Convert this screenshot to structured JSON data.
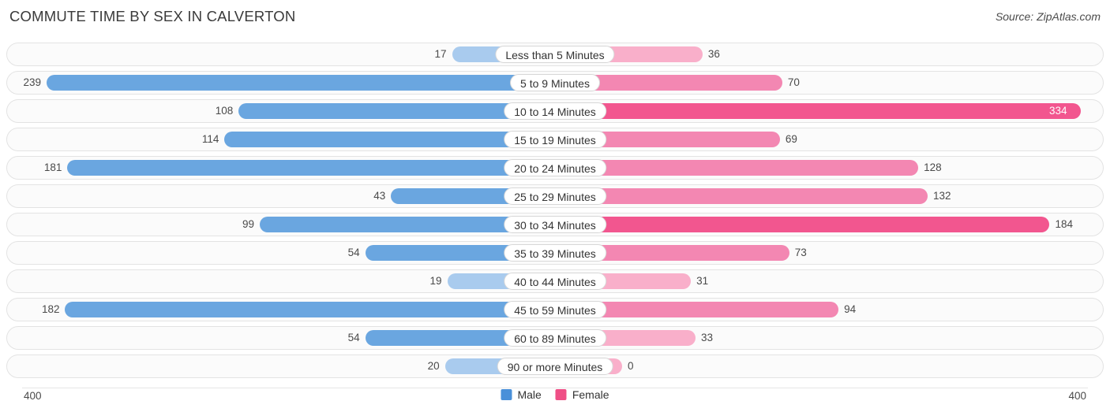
{
  "header": {
    "title": "COMMUTE TIME BY SEX IN CALVERTON",
    "source": "Source: ZipAtlas.com"
  },
  "legend": {
    "male": "Male",
    "female": "Female"
  },
  "axis": {
    "left": "400",
    "right": "400"
  },
  "chart_data": {
    "type": "bar",
    "title": "COMMUTE TIME BY SEX IN CALVERTON",
    "orientation": "horizontal-diverging",
    "xlabel": "",
    "ylabel": "",
    "axis_max": 400,
    "categories": [
      "Less than 5 Minutes",
      "5 to 9 Minutes",
      "10 to 14 Minutes",
      "15 to 19 Minutes",
      "20 to 24 Minutes",
      "25 to 29 Minutes",
      "30 to 34 Minutes",
      "35 to 39 Minutes",
      "40 to 44 Minutes",
      "45 to 59 Minutes",
      "60 to 89 Minutes",
      "90 or more Minutes"
    ],
    "series": [
      {
        "name": "Male",
        "color": "#4a90d9",
        "values": [
          17,
          239,
          108,
          114,
          181,
          43,
          99,
          54,
          19,
          182,
          54,
          20
        ]
      },
      {
        "name": "Female",
        "color": "#ef4f86",
        "values": [
          36,
          70,
          334,
          69,
          128,
          132,
          184,
          73,
          31,
          94,
          33,
          0
        ]
      }
    ],
    "legend_position": "bottom-center",
    "grid": false
  }
}
